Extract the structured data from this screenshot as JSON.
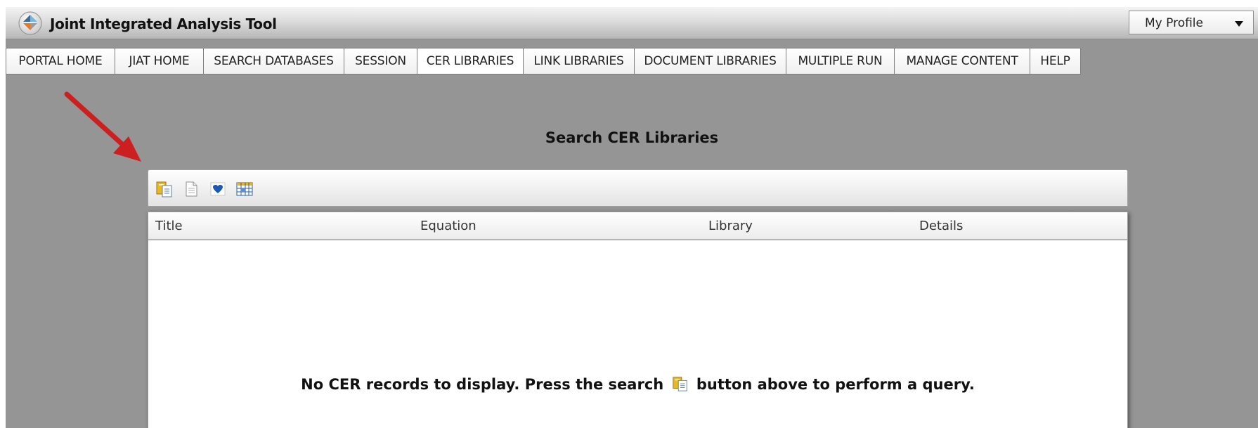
{
  "app": {
    "title": "Joint Integrated Analysis Tool"
  },
  "profile": {
    "label": "My Profile"
  },
  "nav": {
    "items": [
      {
        "label": "PORTAL HOME"
      },
      {
        "label": "JIAT HOME"
      },
      {
        "label": "SEARCH DATABASES"
      },
      {
        "label": "SESSION"
      },
      {
        "label": "CER LIBRARIES",
        "active": true
      },
      {
        "label": "LINK LIBRARIES"
      },
      {
        "label": "DOCUMENT LIBRARIES"
      },
      {
        "label": "MULTIPLE RUN"
      },
      {
        "label": "MANAGE CONTENT"
      },
      {
        "label": "HELP"
      }
    ]
  },
  "page": {
    "title": "Search CER Libraries"
  },
  "toolbar": {
    "icons": [
      "search-icon",
      "document-icon",
      "favorite-heart-icon",
      "table-columns-icon"
    ]
  },
  "grid": {
    "columns": [
      "Title",
      "Equation",
      "Library",
      "Details"
    ],
    "empty_before": "No CER records to display. Press the search",
    "empty_after": "button above to perform a query."
  },
  "colors": {
    "background": "#959595",
    "annotation_arrow": "#cc1f1f"
  }
}
